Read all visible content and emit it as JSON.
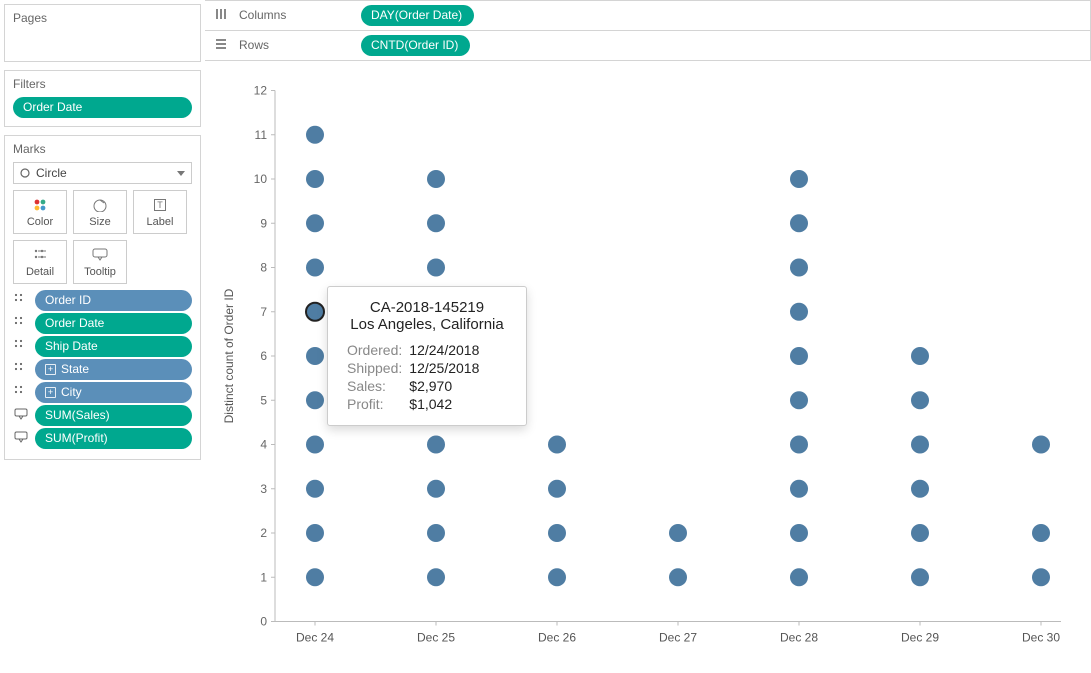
{
  "sidebar": {
    "pages_label": "Pages",
    "filters_label": "Filters",
    "filters": [
      {
        "label": "Order Date",
        "color": "green"
      }
    ],
    "marks_label": "Marks",
    "mark_type": "Circle",
    "mark_buttons": {
      "color": "Color",
      "size": "Size",
      "label": "Label",
      "detail": "Detail",
      "tooltip": "Tooltip"
    },
    "mark_pills": [
      {
        "icon": "detail",
        "label": "Order ID",
        "color": "blue"
      },
      {
        "icon": "detail",
        "label": "Order Date",
        "color": "green"
      },
      {
        "icon": "detail",
        "label": "Ship Date",
        "color": "green"
      },
      {
        "icon": "detail",
        "label": "State",
        "color": "blue",
        "plus": true
      },
      {
        "icon": "detail",
        "label": "City",
        "color": "blue",
        "plus": true
      },
      {
        "icon": "tooltip",
        "label": "SUM(Sales)",
        "color": "green"
      },
      {
        "icon": "tooltip",
        "label": "SUM(Profit)",
        "color": "green"
      }
    ]
  },
  "shelves": {
    "columns_label": "Columns",
    "columns_pill": "DAY(Order Date)",
    "rows_label": "Rows",
    "rows_pill": "CNTD(Order ID)"
  },
  "tooltip": {
    "order_id": "CA-2018-145219",
    "location": "Los Angeles, California",
    "rows": [
      {
        "label": "Ordered:",
        "value": "12/24/2018"
      },
      {
        "label": "Shipped:",
        "value": "12/25/2018"
      },
      {
        "label": "Sales:",
        "value": "$2,970"
      },
      {
        "label": "Profit:",
        "value": "$1,042"
      }
    ]
  },
  "chart_data": {
    "type": "scatter",
    "ylabel": "Distinct count of Order ID",
    "x_categories": [
      "Dec 24",
      "Dec 25",
      "Dec 26",
      "Dec 27",
      "Dec 28",
      "Dec 29",
      "Dec 30"
    ],
    "y_ticks": [
      0,
      1,
      2,
      3,
      4,
      5,
      6,
      7,
      8,
      9,
      10,
      11,
      12
    ],
    "ylim": [
      0,
      12
    ],
    "mark_color": "#4f7da3",
    "mark_radius": 9,
    "points": [
      {
        "x": "Dec 24",
        "ys": [
          1,
          2,
          3,
          4,
          5,
          6,
          7,
          8,
          9,
          10,
          11
        ]
      },
      {
        "x": "Dec 25",
        "ys": [
          1,
          2,
          3,
          4,
          5,
          6,
          7,
          8,
          9,
          10
        ]
      },
      {
        "x": "Dec 26",
        "ys": [
          1,
          2,
          3,
          4
        ]
      },
      {
        "x": "Dec 27",
        "ys": [
          1,
          2
        ]
      },
      {
        "x": "Dec 28",
        "ys": [
          1,
          2,
          3,
          4,
          5,
          6,
          7,
          8,
          9,
          10
        ]
      },
      {
        "x": "Dec 29",
        "ys": [
          1,
          2,
          3,
          4,
          5,
          6
        ]
      },
      {
        "x": "Dec 30",
        "ys": [
          1,
          2,
          4
        ]
      }
    ],
    "highlighted_point": {
      "x": "Dec 24",
      "y": 7
    }
  }
}
